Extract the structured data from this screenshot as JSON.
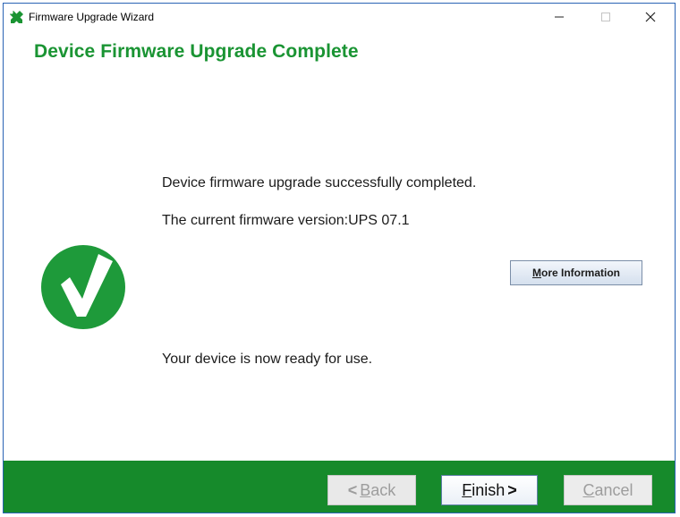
{
  "window": {
    "title": "Firmware Upgrade Wizard",
    "controls": {
      "minimize": "—",
      "maximize": "☐",
      "close": "✕"
    }
  },
  "page": {
    "heading": "Device Firmware Upgrade Complete",
    "message_success": "Device firmware upgrade successfully completed.",
    "message_version": "The current firmware version:UPS 07.1",
    "message_ready": "Your device is now ready for use."
  },
  "buttons": {
    "more_info": {
      "mnemonic": "M",
      "rest": "ore Information"
    },
    "back": {
      "arrow": "<",
      "mnemonic": "B",
      "rest": "ack",
      "enabled": false
    },
    "finish": {
      "mnemonic": "F",
      "rest": "inish",
      "arrow": ">",
      "enabled": true
    },
    "cancel": {
      "mnemonic": "C",
      "rest": "ancel",
      "enabled": false
    }
  },
  "colors": {
    "accent_green": "#1a9433",
    "footer_green": "#168a2b",
    "check_green": "#1e9a3a",
    "window_border": "#2a64b5"
  },
  "icons": {
    "app": "wrench-cross-icon",
    "status": "checkmark-circle-icon"
  }
}
